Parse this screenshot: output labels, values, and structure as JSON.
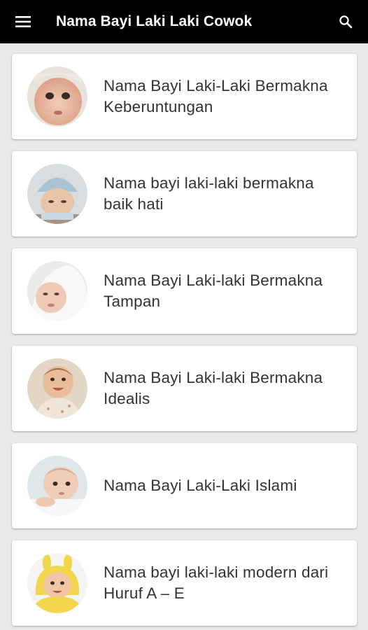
{
  "appbar": {
    "title": "Nama Bayi Laki Laki Cowok",
    "menu_icon": "hamburger-menu-icon",
    "search_icon": "search-icon",
    "background": "#000000",
    "text_color": "#ffffff"
  },
  "items": [
    {
      "title": "Nama Bayi Laki-Laki Bermakna Keberuntungan",
      "image": "baby-photo"
    },
    {
      "title": "Nama bayi laki-laki bermakna baik hati",
      "image": "baby-in-knit-hat-photo"
    },
    {
      "title": "Nama Bayi Laki-laki Bermakna Tampan",
      "image": "baby-in-white-blanket-photo"
    },
    {
      "title": "Nama Bayi Laki-laki Bermakna Idealis",
      "image": "smiling-baby-photo"
    },
    {
      "title": "Nama Bayi Laki-Laki Islami",
      "image": "baby-lying-down-photo"
    },
    {
      "title": "Nama bayi laki-laki modern dari Huruf A – E",
      "image": "baby-in-yellow-hood-photo"
    }
  ]
}
